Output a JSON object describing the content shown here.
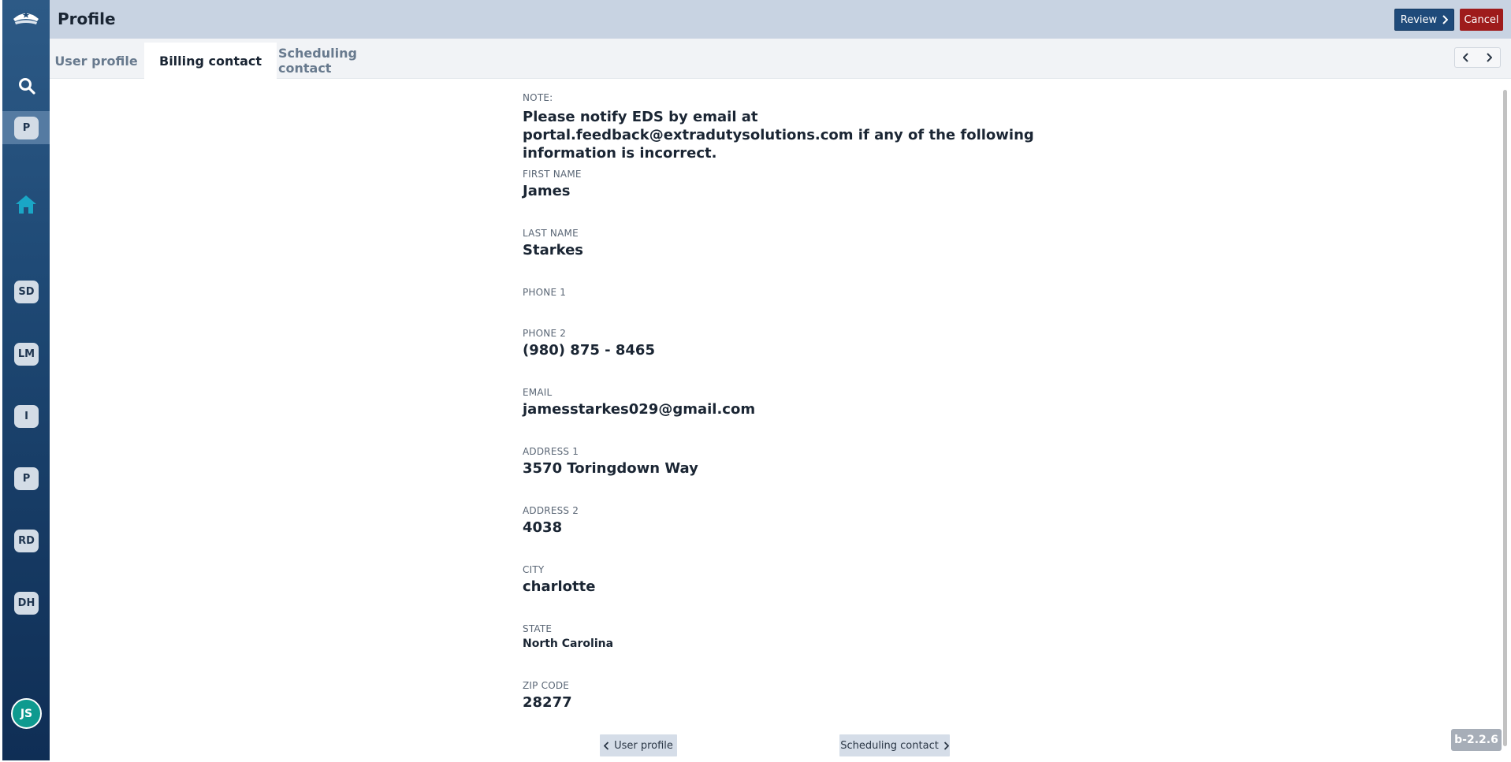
{
  "sidebar": {
    "badges": [
      "P",
      "SD",
      "LM",
      "I",
      "P",
      "RD",
      "DH"
    ],
    "avatar": "JS"
  },
  "header": {
    "title": "Profile",
    "review_label": "Review",
    "cancel_label": "Cancel"
  },
  "tabs": [
    "User profile",
    "Billing contact",
    "Scheduling contact"
  ],
  "form": {
    "note_label": "NOTE:",
    "note_text": "Please notify EDS by email at portal.feedback@extradutysolutions.com if any of the following information is incorrect.",
    "first_name_label": "FIRST NAME",
    "first_name": "James",
    "last_name_label": "LAST NAME",
    "last_name": "Starkes",
    "phone1_label": "PHONE 1",
    "phone1": "",
    "phone2_label": "PHONE 2",
    "phone2": "(980) 875 - 8465",
    "email_label": "EMAIL",
    "email": "jamesstarkes029@gmail.com",
    "address1_label": "ADDRESS 1",
    "address1": "3570 Toringdown Way",
    "address2_label": "ADDRESS 2",
    "address2": "4038",
    "city_label": "CITY",
    "city": "charlotte",
    "state_label": "STATE",
    "state": "North Carolina",
    "zip_label": "ZIP CODE",
    "zip": "28277"
  },
  "footer": {
    "prev_label": "User profile",
    "next_label": "Scheduling contact",
    "version": "b-2.2.6"
  },
  "colors": {
    "header_bg": "#c8d3e2",
    "review_bg": "#1e4a7a",
    "cancel_bg": "#9e1b1b",
    "avatar_bg": "#0e9a8f",
    "sidebar_top": "#2d5a86",
    "sidebar_bottom": "#0f2e55"
  }
}
